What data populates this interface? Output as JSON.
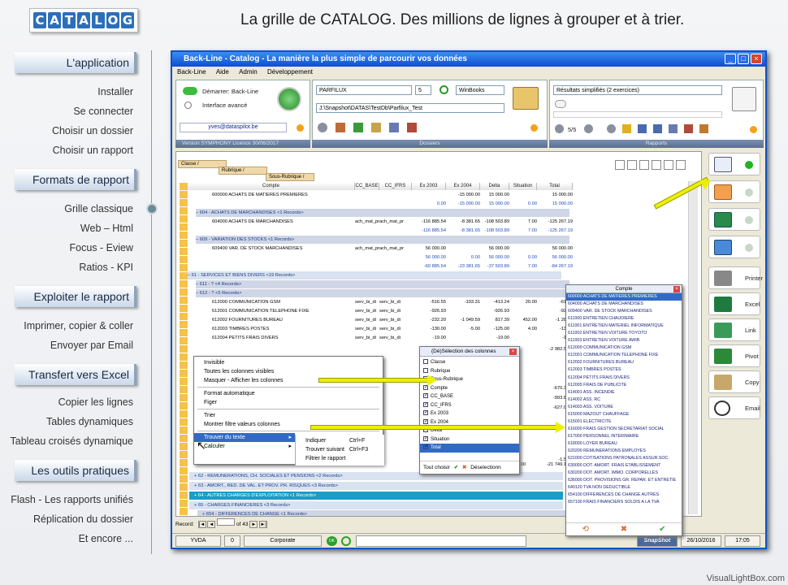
{
  "logo": {
    "letters": [
      "C",
      "A",
      "T",
      "A",
      "L",
      "O",
      "G"
    ]
  },
  "headline": "La grille de CATALOG. Des millions de lignes à grouper et à trier.",
  "sections": [
    {
      "title": "L'application",
      "items": [
        "Installer",
        "Se connecter",
        "Choisir un dossier",
        "Choisir un rapport"
      ]
    },
    {
      "title": "Formats de rapport",
      "items": [
        "Grille classique",
        "Web – Html",
        "Focus - Eview",
        "Ratios - KPI"
      ]
    },
    {
      "title": "Exploiter le rapport",
      "items": [
        "Imprimer, copier & coller",
        "Envoyer par Email"
      ]
    },
    {
      "title": "Transfert vers Excel",
      "items": [
        "Copier les lignes",
        "Tables dynamiques",
        "Tableau croisés dynamique"
      ]
    },
    {
      "title": "Les outils pratiques",
      "items": [
        "Flash - Les rapports unifiés",
        "Réplication du dossier",
        "Et encore ..."
      ]
    }
  ],
  "window": {
    "title": "Back-Line - Catalog - La manière la plus simple de parcourir vos données",
    "menu": [
      "Back-Line",
      "Aide",
      "Admin",
      "Développement"
    ],
    "left_panel": {
      "option1": "Démarrer: Back-Line",
      "option2": "Interface avancé",
      "email": "yves@dataspilot.be",
      "version": "Version  SYMPHONY   Licence  30/06/2017"
    },
    "dossier": {
      "name": "PARFILUX",
      "num": "5",
      "software": "WinBooks",
      "path": "J:\\Snapshot\\DATAS\\TestDb\\Parfilux_Test",
      "label": "Dossiers"
    },
    "rapports": {
      "name": "Résultats simplifiés (2 exercices)",
      "pager": "5/5",
      "label": "Rapports"
    },
    "group_chips": [
      "Classe",
      "Rubrique",
      "Sous-Rubrique"
    ],
    "columns": [
      "Compte",
      "CC_BASE",
      "CC_IFRS",
      "Ex 2003",
      "Ex 2004",
      "Delta",
      "Situation",
      "Total"
    ],
    "rows": [
      {
        "type": "data",
        "c": [
          "600000 ACHATS DE MATIERES PREMIERES",
          "",
          "",
          "",
          "-15 000.00",
          "15 000.00",
          "",
          "15 000.00"
        ]
      },
      {
        "type": "sum",
        "c": [
          "",
          "",
          "",
          "0.00",
          "-15 000.00",
          "15 000.00",
          "0.00",
          "15 000.00"
        ]
      },
      {
        "type": "grp2",
        "c": [
          "604 - ACHATS DE MARCHANDISES   <1 Records>"
        ]
      },
      {
        "type": "data",
        "c": [
          "604000 ACHATS DE MARCHANDISES",
          "ach_mat_pr",
          "ach_mat_pr",
          "-116 885.54",
          "-8 381.65",
          "-108 503.89",
          "7.00",
          "-125 267.19"
        ]
      },
      {
        "type": "sum",
        "c": [
          "",
          "",
          "",
          "-116 885.54",
          "-8 381.65",
          "-108 503.89",
          "7.00",
          "-125 267.19"
        ]
      },
      {
        "type": "grp2",
        "c": [
          "609 - VARIATION DES STOCKS   <1 Records>"
        ]
      },
      {
        "type": "data",
        "c": [
          "609400 VAR. DE STOCK MARCHANDISES",
          "ach_mat_pr",
          "ach_mat_pr",
          "56 000.00",
          "",
          "56 000.00",
          "",
          "56 000.00"
        ]
      },
      {
        "type": "sum",
        "c": [
          "",
          "",
          "",
          "56 000.00",
          "0.00",
          "56 000.00",
          "0.00",
          "56 000.00"
        ]
      },
      {
        "type": "sum",
        "c": [
          "",
          "",
          "",
          "-60 885.54",
          "-23 381.65",
          "-37 503.89",
          "7.00",
          "-84 267.19"
        ]
      },
      {
        "type": "grp",
        "c": [
          "61 - SERVICES ET BIENS DIVERS   <19 Records>"
        ]
      },
      {
        "type": "grp2",
        "c": [
          "611 - ?   <4 Records>"
        ]
      },
      {
        "type": "grp2",
        "c": [
          "612 - ?   <5 Records>"
        ]
      },
      {
        "type": "data",
        "c": [
          "612000 COMMUNICATION GSM",
          "serv_bi_di",
          "serv_bi_di",
          "-516.55",
          "-103.31",
          "-413.24",
          "20.00",
          "-619.8"
        ]
      },
      {
        "type": "data",
        "c": [
          "612001 COMMUNICATION TELEPHONE FIXE",
          "serv_bi_di",
          "serv_bi_di",
          "-926.93",
          "",
          "-926.93",
          "",
          "-926.9"
        ]
      },
      {
        "type": "data",
        "c": [
          "612002 FOURNITURES BUREAU",
          "serv_bi_di",
          "serv_bi_di",
          "-232.20",
          "-1 049.59",
          "817.39",
          "452.00",
          "-1 281.7"
        ]
      },
      {
        "type": "data",
        "c": [
          "612003 TIMBRES POSTES",
          "serv_bi_di",
          "serv_bi_di",
          "-130.00",
          "-5.00",
          "-125.00",
          "4.00",
          "-135.0"
        ]
      },
      {
        "type": "data",
        "c": [
          "612004 PETITS FRAIS DIVERS",
          "serv_bi_di",
          "serv_bi_di",
          "-19.00",
          "",
          "-19.00",
          "",
          "-19.0"
        ]
      }
    ],
    "partial_values": [
      "-2 982.5",
      "-670.3",
      "-993.8",
      "-627.0",
      "-1.5"
    ],
    "bottom_groups": [
      "62 - REMUNERATIONS, CH. SOCIALES ET PENSIONS   <2 Records>",
      "63 - AMORT., RED. DE VAL. ET PROV. PR. RISQUES   <3 Records>",
      "64 - AUTRES CHARGES D'EXPLOITATION   <1 Records>",
      "65 - CHARGES FINANCIERES   <3 Records>",
      "654 - DIFFERENCES DE CHANGE   <1 Records>"
    ],
    "footer_values": {
      "delta": "06.00",
      "total": "-21 749.1"
    },
    "record_nav": {
      "label": "Record:",
      "of": "of 43"
    },
    "context_menu": {
      "group1": [
        "Invisible",
        "Toutes les colonnes visibles",
        "Masquer - Afficher les colonnes"
      ],
      "group2": [
        "Format automatique",
        "Figer"
      ],
      "group3": [
        "Trier",
        "Montrer filtre valeurs colonnes"
      ],
      "group4": [
        "Trouver du texte",
        "Calculer"
      ],
      "submenu": [
        {
          "label": "Indiquer",
          "key": "Ctrl+F"
        },
        {
          "label": "Trouver suivant",
          "key": "Ctrl+F3"
        },
        {
          "label": "Filtrer le rapport",
          "key": ""
        }
      ]
    },
    "col_dialog": {
      "title": "(Dé)Sélection des colonnes",
      "items": [
        {
          "label": "Classe",
          "checked": false
        },
        {
          "label": "Rubrique",
          "checked": false
        },
        {
          "label": "Sous-Rubrique",
          "checked": false
        },
        {
          "label": "Compte",
          "checked": true
        },
        {
          "label": "CC_BASE",
          "checked": true
        },
        {
          "label": "CC_IFRS",
          "checked": true
        },
        {
          "label": "Ex 2003",
          "checked": true
        },
        {
          "label": "Ex 2004",
          "checked": true
        },
        {
          "label": "Delta",
          "checked": true
        },
        {
          "label": "Situation",
          "checked": true
        },
        {
          "label": "Total",
          "checked": true
        }
      ],
      "all": "Tout choisir",
      "none": "Déselectionn"
    },
    "account_list": {
      "title": "Compte",
      "items": [
        "600000 ACHATS DE MATIERES PREMIERES",
        "604000 ACHATS DE MARCHANDISES",
        "609400 VAR. DE STOCK MARCHANDISES",
        "611000 ENTRETIEN CHAUDIERE",
        "611001 ENTRETIEN MATERIEL INFORMATIQUE",
        "611002 ENTRETIEN VOITURE TOYOTO",
        "611003 ENTRETIEN VOITURE AWIB",
        "612000 COMMUNICATION GSM",
        "612001 COMMUNICATION TELEPHONE FIXE",
        "612002 FOURNITURES BUREAU",
        "612003 TIMBRES POSTES",
        "612004 PETITS FRAIS DIVERS",
        "612005 FRAIS DE PUBLICITE",
        "614001 ASS. INCENDIE",
        "614002 ASS. RC",
        "614003 ASS. VOITURE",
        "615000 MAZOUT CHAUFFAGE",
        "615001 ELECTRICITE",
        "616000 FRAIS GESTION SECRETARIAT SOCIAL",
        "617000 PERSONNEL INTERIMAIRE",
        "618000 LOYER BUREAU",
        "620200 REMUNERATIONS  EMPLOYES",
        "621000 COTISATIONS PATRONALES ASSUR.SOC.",
        "630000 DOT. AMORT. FRAIS ETABLISSEMENT",
        "630200 DOT. AMORT. IMMO. CORPORELLES",
        "636000 DOT. PROVISIONS GR. REPAR. ET ENTRETIE",
        "640120 TVA NON DEDUCTIBLE",
        "654100 DIFFERENCES DE CHANGE AUTRES",
        "657100 FRAIS FINANCIERS SOLDIS A LA TVA"
      ]
    },
    "right_buttons": [
      "Printer",
      "Excel",
      "Link",
      "Pivot",
      "Copy",
      "Email"
    ],
    "status": {
      "user": "YVDA",
      "num": "0",
      "profile": "Corporate",
      "ok": "OK",
      "brand": "SnapShot",
      "date": "26/10/2016",
      "time": "17:05"
    }
  },
  "watermark": "VisualLightBox.com",
  "colors": {
    "accent": "#ecf000",
    "titlebar": "#0a4fd0",
    "selected": "#1a9dc8"
  }
}
